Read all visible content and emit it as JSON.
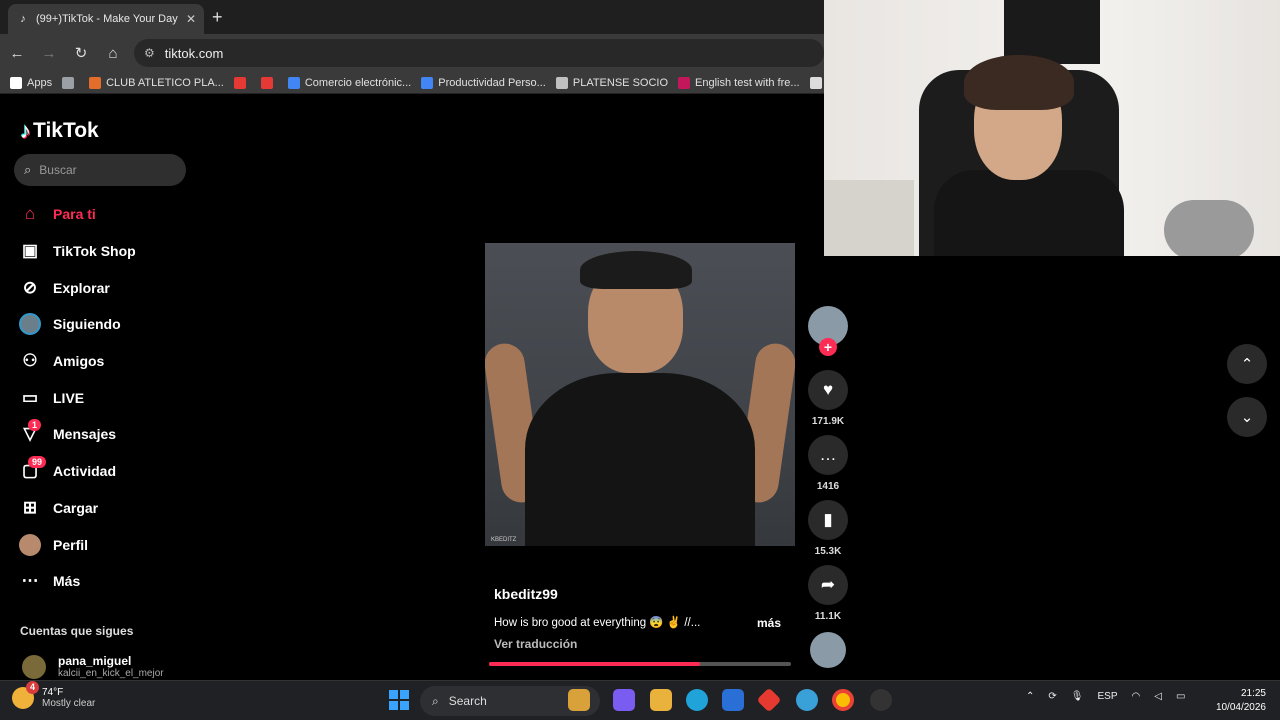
{
  "browser": {
    "tab_title": "(99+)TikTok - Make Your Day",
    "url": "tiktok.com",
    "bookmarks": [
      {
        "label": "Apps",
        "color": "#ffffff"
      },
      {
        "label": "",
        "color": "#9aa0a6"
      },
      {
        "label": "CLUB ATLETICO PLA...",
        "color": "#e36d2a"
      },
      {
        "label": "",
        "color": "#e53935"
      },
      {
        "label": "",
        "color": "#e53935"
      },
      {
        "label": "Comercio electrónic...",
        "color": "#4285f4"
      },
      {
        "label": "Productividad Perso...",
        "color": "#4285f4"
      },
      {
        "label": "PLATENSE SOCIO",
        "color": "#c0c0c0"
      },
      {
        "label": "English test with fre...",
        "color": "#c2185b"
      },
      {
        "label": "entrad",
        "color": "#dddddd"
      }
    ]
  },
  "sidebar": {
    "brand": "TikTok",
    "search_placeholder": "Buscar",
    "items": [
      {
        "label": "Para ti",
        "icon": "home-icon",
        "active": true
      },
      {
        "label": "TikTok Shop",
        "icon": "shop-icon"
      },
      {
        "label": "Explorar",
        "icon": "compass-icon"
      },
      {
        "label": "Siguiendo",
        "icon": "following-avatar-icon"
      },
      {
        "label": "Amigos",
        "icon": "friends-icon"
      },
      {
        "label": "LIVE",
        "icon": "live-icon"
      },
      {
        "label": "Mensajes",
        "icon": "messages-icon",
        "badge": "1"
      },
      {
        "label": "Actividad",
        "icon": "activity-icon",
        "badge": "99"
      },
      {
        "label": "Cargar",
        "icon": "upload-icon"
      },
      {
        "label": "Perfil",
        "icon": "profile-avatar-icon"
      },
      {
        "label": "Más",
        "icon": "more-icon"
      }
    ],
    "following_title": "Cuentas que sigues",
    "following": [
      {
        "name": "pana_miguel",
        "sub": "kalcii_en_kick_el_mejor"
      }
    ]
  },
  "video": {
    "watermark": "KBEDITZ",
    "username": "kbeditz99",
    "description": "How is bro good at everything 😨 ✌️ //...",
    "more_label": "más",
    "translate_label": "Ver traducción",
    "progress": 0.7
  },
  "actions": {
    "likes": "171.9K",
    "comments": "1416",
    "saves": "15.3K",
    "shares": "11.1K"
  },
  "taskbar": {
    "temp": "74°F",
    "weather": "Mostly clear",
    "weather_badge": "4",
    "search_label": "Search",
    "lang": "ESP",
    "time": "21:25",
    "date": "10/04/2026"
  }
}
